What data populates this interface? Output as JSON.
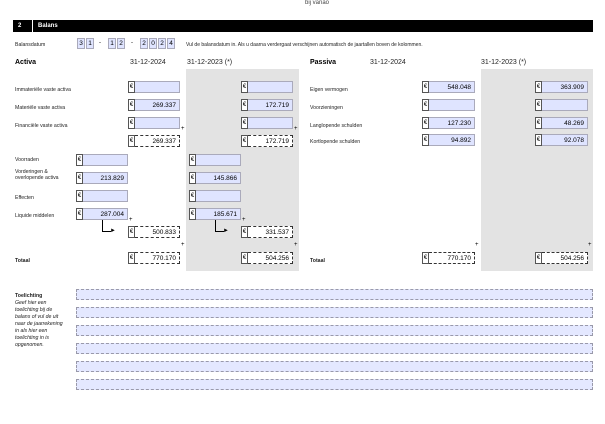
{
  "page_top_fragment": "bij vanao",
  "header": {
    "number": "2",
    "title": "Balans"
  },
  "balansdatum": {
    "label": "Balansdatum",
    "day": [
      "3",
      "1"
    ],
    "month": [
      "1",
      "2"
    ],
    "year": [
      "2",
      "0",
      "2",
      "4"
    ],
    "hint": "Vul de balansdatum in. Als u daarna verdergaat verschijnen automatisch de jaartallen boven de kolommen."
  },
  "activa": {
    "title": "Activa",
    "col_current": "31-12-2024",
    "col_prior": "31-12-2023 (*)",
    "currency": "€",
    "rows": {
      "immaterieel": {
        "label": "Immateriële vaste activa",
        "current": "",
        "prior": ""
      },
      "materieel": {
        "label": "Materiële vaste activa",
        "current": "269.337",
        "prior": "172.719"
      },
      "financieel": {
        "label": "Financiële vaste activa",
        "current": "",
        "prior": ""
      },
      "vaste_subtotal": {
        "current": "269.337",
        "prior": "172.719"
      },
      "voorraden": {
        "label": "Voorraden",
        "current": "",
        "prior": ""
      },
      "vorderingen": {
        "label": "Vorderingen & overlopende activa",
        "current": "213.829",
        "prior": "145.866"
      },
      "effecten": {
        "label": "Effecten",
        "current": "",
        "prior": ""
      },
      "liquide": {
        "label": "Liquide middelen",
        "current": "287.004",
        "prior": "185.671"
      },
      "vlottende_subtotal": {
        "current": "500.833",
        "prior": "331.537"
      }
    },
    "total_label": "Totaal",
    "total": {
      "current": "770.170",
      "prior": "504.256"
    }
  },
  "passiva": {
    "title": "Passiva",
    "col_current": "31-12-2024",
    "col_prior": "31-12-2023 (*)",
    "currency": "€",
    "rows": {
      "eigen": {
        "label": "Eigen vermogen",
        "current": "548.048",
        "prior": "363.909"
      },
      "voorzieningen": {
        "label": "Voorzieningen",
        "current": "",
        "prior": ""
      },
      "langlopend": {
        "label": "Langlopende schulden",
        "current": "127.230",
        "prior": "48.269"
      },
      "kortlopend": {
        "label": "Kortlopende schulden",
        "current": "94.892",
        "prior": "92.078"
      }
    },
    "total_label": "Totaal",
    "total": {
      "current": "770.170",
      "prior": "504.256"
    }
  },
  "plus": "+",
  "toelichting": {
    "title": "Toelichting",
    "note_lines": [
      "Geef hier een",
      "toelichting bij de",
      "balans of vul de uit",
      "naar de jaarrekening",
      "in als hier een",
      "toelichting in is",
      "opgenomen."
    ]
  }
}
